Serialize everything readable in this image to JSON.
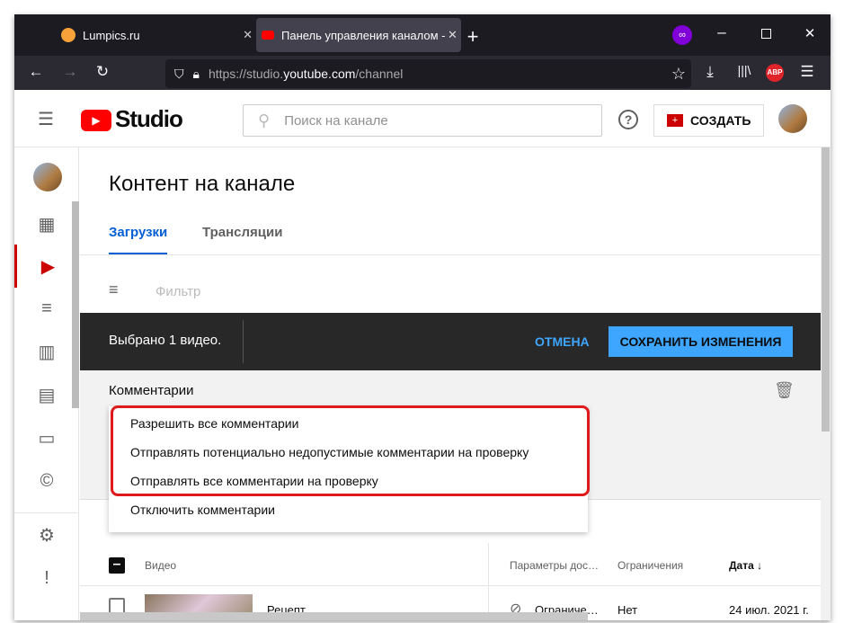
{
  "browser": {
    "tabs": [
      {
        "title": "Lumpics.ru",
        "icon": "orange-icon"
      },
      {
        "title": "Панель управления каналом - ",
        "icon": "youtube-icon"
      }
    ],
    "new_tab": "+",
    "url_host_prefix": "https://studio.",
    "url_host": "youtube.com",
    "url_path": "/channel",
    "abp": "ABP"
  },
  "header": {
    "logo": "Studio",
    "search_placeholder": "Поиск на канале",
    "create": "СОЗДАТЬ"
  },
  "page": {
    "title": "Контент на канале",
    "tabs": [
      "Загрузки",
      "Трансляции"
    ],
    "filter": "Фильтр"
  },
  "selection": {
    "text": "Выбрано 1 видео.",
    "cancel": "ОТМЕНА",
    "save": "СОХРАНИТЬ ИЗМЕНЕНИЯ"
  },
  "edit": {
    "field": "Комментарии"
  },
  "menu": {
    "items": [
      "Разрешить все комментарии",
      "Отправлять потенциально недопустимые комментарии на проверку",
      "Отправлять все комментарии на проверку",
      "Отключить комментарии"
    ]
  },
  "table": {
    "headers": [
      "Видео",
      "Параметры дос…",
      "Ограничения",
      "Дата ↓"
    ],
    "rows": [
      {
        "title": "Рецепт",
        "visibility": "Ограниче…",
        "restrictions": "Нет",
        "date": "24 июл. 2021 г."
      }
    ]
  },
  "colors": {
    "accent": "#065fd4",
    "highlight": "#e0191c",
    "save": "#3ea6ff"
  }
}
